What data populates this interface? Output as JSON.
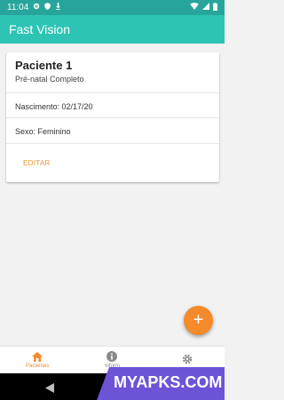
{
  "status_bar": {
    "time": "11:04"
  },
  "app_bar": {
    "title": "Fast Vision"
  },
  "patient_card": {
    "name": "Paciente 1",
    "subtitle": "Pré-natal Completo",
    "birth": "Nascimento: 02/17/20",
    "sex": "Sexo: Feminino",
    "edit_label": "EDITAR"
  },
  "fab": {
    "label": "+"
  },
  "bottom_nav": {
    "items": [
      {
        "label": "Pacientes",
        "icon": "home-icon",
        "active": true
      },
      {
        "label": "Inform",
        "icon": "info-icon",
        "active": false
      },
      {
        "label": "",
        "icon": "gear-icon",
        "active": false
      }
    ]
  },
  "watermark": {
    "text": "MYAPKS.COM"
  },
  "colors": {
    "status_bar": "#27a59b",
    "app_bar": "#2ec4b4",
    "accent": "#f48a2c",
    "watermark": "#6d53d6"
  }
}
